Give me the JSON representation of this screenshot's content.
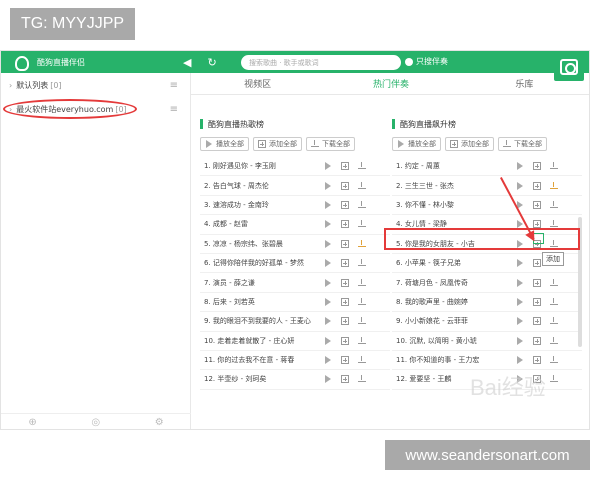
{
  "overlay": {
    "top_tag": "TG: MYYJJPP",
    "bottom_tag": "www.seandersonart.com",
    "watermark": "Bai经验"
  },
  "app": {
    "title": "酷狗直播伴侣",
    "search_placeholder": "搜索歌曲 · 歌手或歌词",
    "only_search_songs": "只搜伴奏",
    "refresh_icon": "refresh-icon",
    "back_icon": "back-icon",
    "scan_icon": "scan-icon"
  },
  "sidebar": {
    "items": [
      {
        "label": "默认列表",
        "count": "[0]"
      },
      {
        "label": "最火软件站everyhuo.com",
        "count": "[0]"
      }
    ]
  },
  "tabs": [
    {
      "label": "视频区",
      "active": false
    },
    {
      "label": "热门伴奏",
      "active": true
    },
    {
      "label": "乐库",
      "active": false
    }
  ],
  "left_panel": {
    "title": "酷狗直播热歌榜",
    "actions": [
      "播放全部",
      "添加全部",
      "下载全部"
    ],
    "songs": [
      "1. 刚好遇见你 - 李玉刚",
      "2. 告白气球 - 周杰伦",
      "3. 速溶成功 - 金南玲",
      "4. 成都 - 赵雷",
      "5. 凉凉 - 杨宗纬、张碧晨",
      "6. 记得你陪伴我的好孤单 - 梦然",
      "7. 演员 - 薛之谦",
      "8. 后来 - 刘若英",
      "9. 我的眼泪不到我要的人 - 王麦心",
      "10. 走着走着就散了 - 庄心妍",
      "11. 你的过去我不在意 - 蒋春",
      "12. 半壶纱 - 刘珂矣"
    ]
  },
  "right_panel": {
    "title": "酷狗直播飙升榜",
    "actions": [
      "播放全部",
      "添加全部",
      "下载全部"
    ],
    "songs": [
      "1. 约定 - 周蕙",
      "2. 三生三世 - 张杰",
      "3. 你不懂 - 林小黎",
      "4. 女儿情 - 梁静",
      "5. 你是我的女朋友 - 小吉",
      "6. 小苹果 - 筷子兄弟",
      "7. 荷塘月色 - 凤凰传奇",
      "8. 我的歌声里 - 曲婉婷",
      "9. 小小新娘花 - 云菲菲",
      "10. 沉默, 以简明 - 黄小琥",
      "11. 你不知道的事 - 王力宏",
      "12. 爱要坚 - 王麟"
    ],
    "tooltip": "添加"
  },
  "colors": {
    "accent": "#27b26a",
    "highlight": "#e43a3a"
  }
}
